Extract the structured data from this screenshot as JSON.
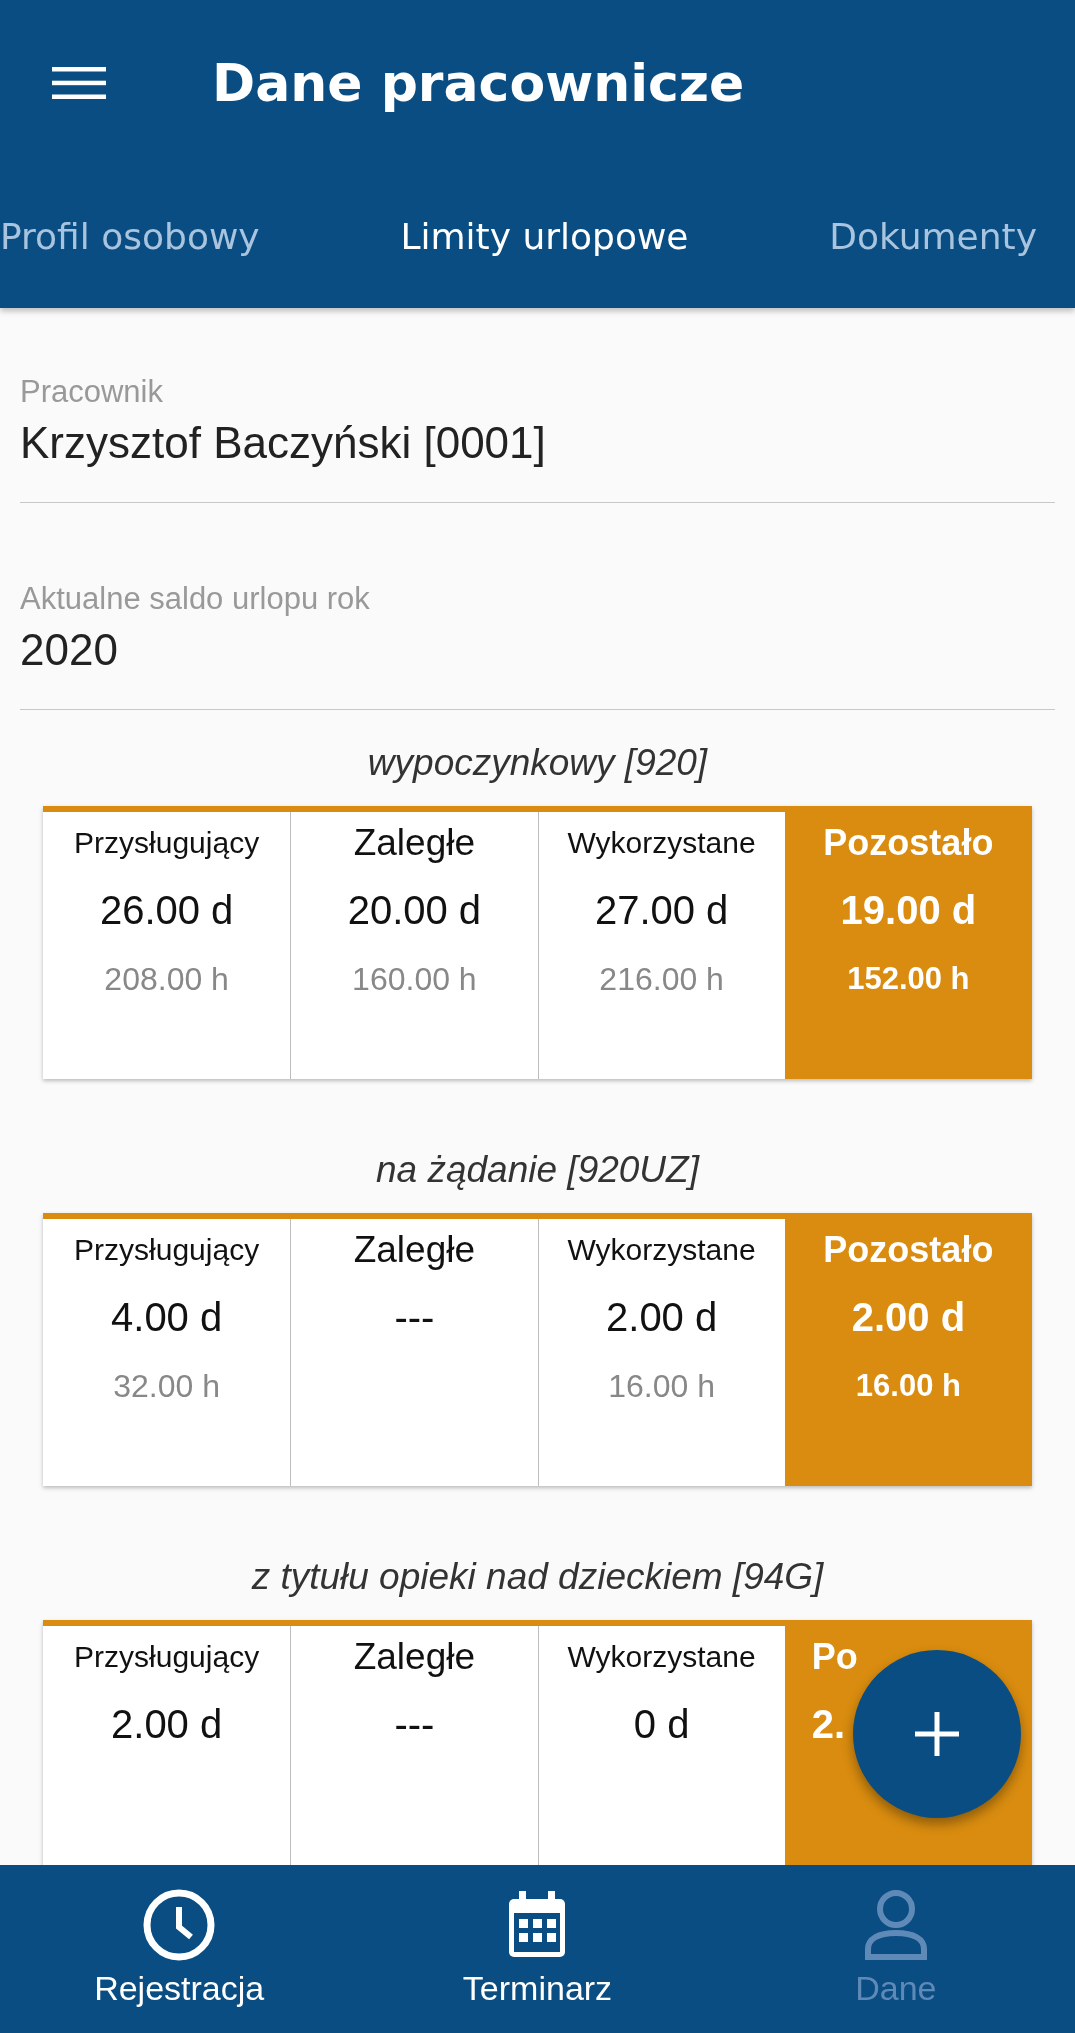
{
  "app_bar": {
    "title": "Dane pracownicze"
  },
  "tabs": [
    {
      "label": "Profil osobowy",
      "selected": false
    },
    {
      "label": "Limity urlopowe",
      "selected": true
    },
    {
      "label": "Dokumenty",
      "selected": false
    }
  ],
  "fields": [
    {
      "label": "Pracownik",
      "value": "Krzysztof Baczyński [0001]"
    },
    {
      "label": "Aktualne saldo urlopu rok",
      "value": "2020"
    }
  ],
  "leave_types": [
    {
      "title": "wypoczynkowy [920]",
      "columns": [
        {
          "kind": "entitled",
          "label": "Przysługujący",
          "days": "26.00 d",
          "hours": "208.00 h"
        },
        {
          "kind": "overdue",
          "label": "Zaległe",
          "days": "20.00 d",
          "hours": "160.00 h"
        },
        {
          "kind": "used",
          "label": "Wykorzystane",
          "days": "27.00 d",
          "hours": "216.00 h"
        },
        {
          "kind": "remaining",
          "label": "Pozostało",
          "days": "19.00 d",
          "hours": "152.00 h"
        }
      ]
    },
    {
      "title": "na żądanie [920UZ]",
      "columns": [
        {
          "kind": "entitled",
          "label": "Przysługujący",
          "days": "4.00 d",
          "hours": "32.00 h"
        },
        {
          "kind": "overdue",
          "label": "Zaległe",
          "days": "---"
        },
        {
          "kind": "used",
          "label": "Wykorzystane",
          "days": "2.00 d",
          "hours": "16.00 h"
        },
        {
          "kind": "remaining",
          "label": "Pozostało",
          "days": "2.00 d",
          "hours": "16.00 h"
        }
      ]
    },
    {
      "title": "z tytułu opieki nad dzieckiem [94G]",
      "columns": [
        {
          "kind": "entitled",
          "label": "Przysługujący",
          "days": "2.00 d"
        },
        {
          "kind": "overdue",
          "label": "Zaległe",
          "days": "---"
        },
        {
          "kind": "used",
          "label": "Wykorzystane",
          "days": "0 d"
        },
        {
          "kind": "remaining_cut",
          "label": "Po",
          "days": "2."
        }
      ]
    }
  ],
  "bottom_nav": [
    {
      "kind": "clock",
      "label": "Rejestracja",
      "selected": false
    },
    {
      "kind": "calendar",
      "label": "Terminarz",
      "selected": false
    },
    {
      "kind": "person",
      "label": "Dane",
      "selected": true
    }
  ]
}
